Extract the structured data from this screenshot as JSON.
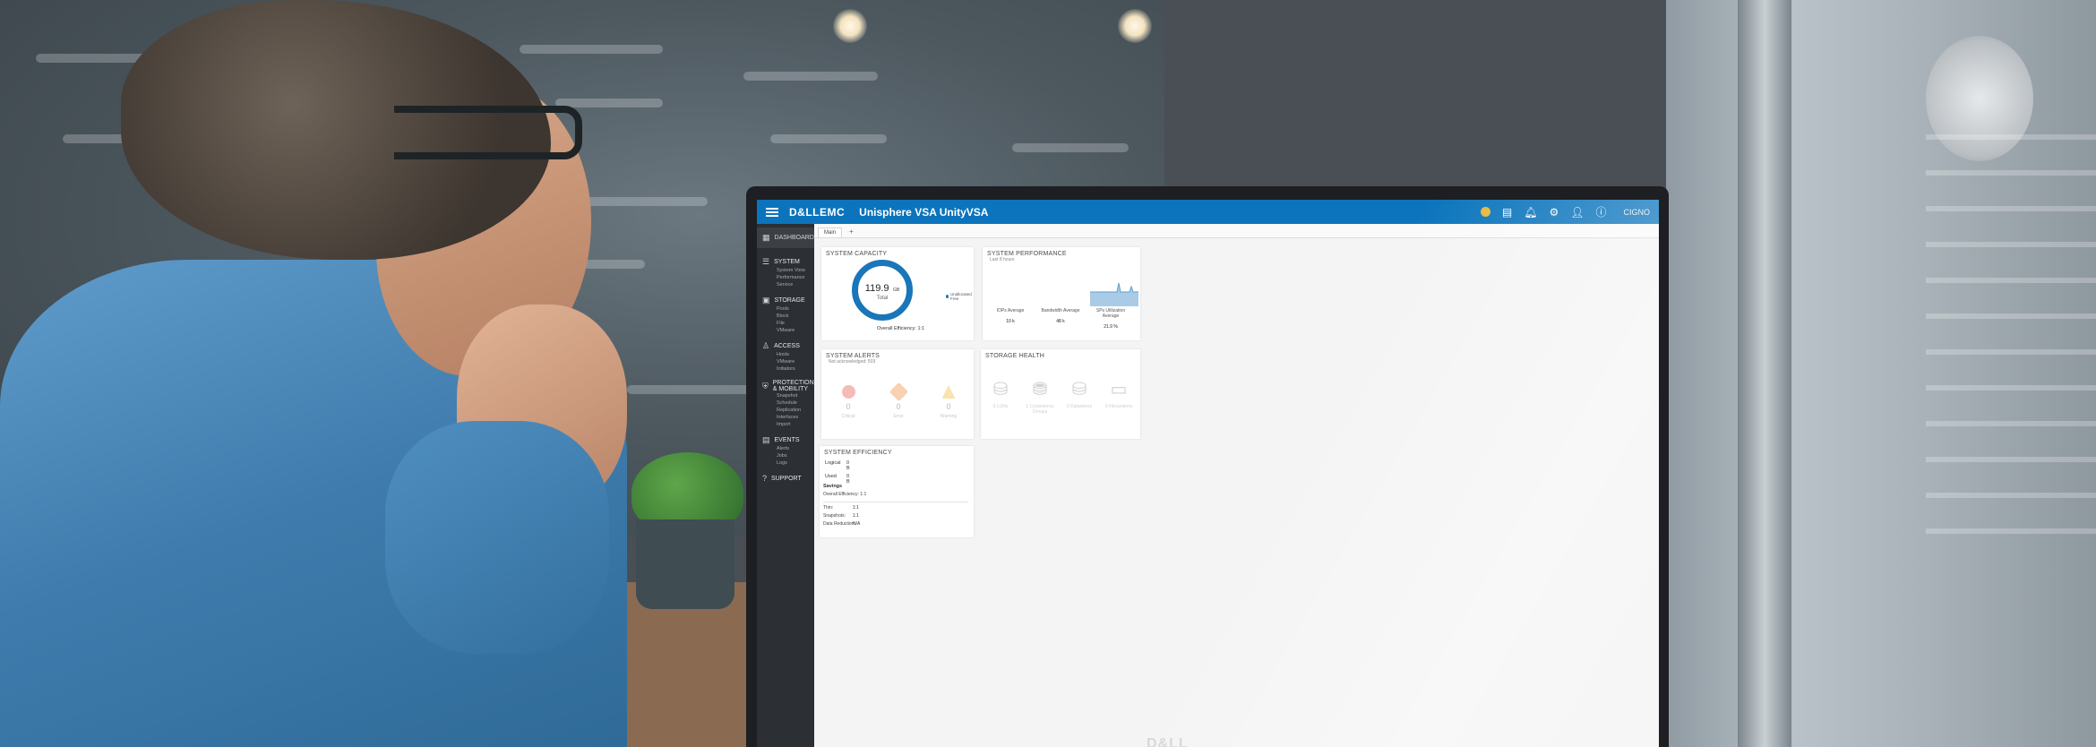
{
  "header": {
    "brand": "D&LLEMC",
    "title": "Unisphere VSA UnityVSA",
    "user_name": "CIGNO"
  },
  "sidebar": {
    "dashboard": "DASHBOARD",
    "groups": [
      {
        "label": "SYSTEM",
        "items": [
          "System View",
          "Performance",
          "Service"
        ]
      },
      {
        "label": "STORAGE",
        "items": [
          "Pools",
          "Block",
          "File",
          "VMware"
        ]
      },
      {
        "label": "ACCESS",
        "items": [
          "Hosts",
          "VMware",
          "Initiators"
        ]
      },
      {
        "label": "PROTECTION & MOBILITY",
        "items": [
          "Snapshot Schedule",
          "Replication",
          "Interfaces",
          "Import"
        ]
      },
      {
        "label": "EVENTS",
        "items": [
          "Alerts",
          "Jobs",
          "Logs"
        ]
      },
      {
        "label": "SUPPORT",
        "items": []
      }
    ]
  },
  "tabs": {
    "main": "Main",
    "add": "+"
  },
  "capacity": {
    "title": "SYSTEM CAPACITY",
    "value": "119.9",
    "unit": "GB",
    "label": "Total",
    "legend": "Unallocated Free",
    "efficiency": "Overall Efficiency: 1:1"
  },
  "performance": {
    "title": "SYSTEM PERFORMANCE",
    "subtitle": "Last 8 hours",
    "metrics": [
      {
        "label": "IOPs Average",
        "value": "10 k"
      },
      {
        "label": "Bandwidth Average",
        "value": "48 k"
      },
      {
        "label": "SPs Utilization Average",
        "value": "21.9 %"
      }
    ]
  },
  "alerts": {
    "title": "SYSTEM ALERTS",
    "subtitle": "Not acknowledged: 503",
    "items": [
      {
        "count": "0",
        "label": "Critical"
      },
      {
        "count": "0",
        "label": "Error"
      },
      {
        "count": "0",
        "label": "Warning"
      }
    ]
  },
  "health": {
    "title": "STORAGE HEALTH",
    "items": [
      {
        "label": "0  LUNs"
      },
      {
        "label": "1  Consistency Groups"
      },
      {
        "label": "0  Datastores"
      },
      {
        "label": "0  Filesystems"
      }
    ]
  },
  "efficiency": {
    "title": "SYSTEM EFFICIENCY",
    "logical_label": "Logical",
    "logical_value": "0 B",
    "used_label": "Used",
    "used_value": "0 B",
    "savings_label": "Savings",
    "overall": "Overall Efficiency: 1:1",
    "rows": [
      {
        "label": "Thin:",
        "value": "1:1"
      },
      {
        "label": "Snapshots:",
        "value": "1:1"
      },
      {
        "label": "Data Reduction:",
        "value": "N/A"
      }
    ]
  },
  "monitor_logo": "D&LL",
  "colors": {
    "brand_blue": "#0b74bc",
    "sidebar": "#2c2f33",
    "donut": "#1976b8"
  }
}
